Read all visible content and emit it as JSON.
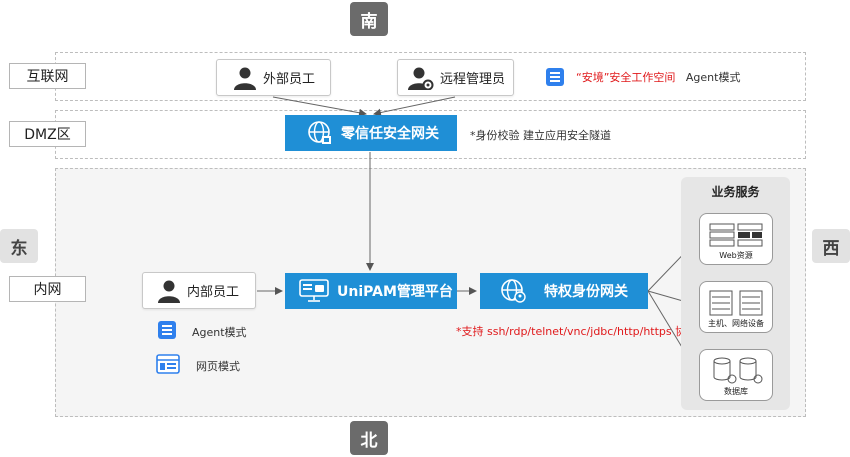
{
  "directions": {
    "south": "南",
    "north": "北",
    "east": "东",
    "west": "西"
  },
  "zones": {
    "internet": "互联网",
    "dmz": "DMZ区",
    "intranet": "内网"
  },
  "nodes": {
    "external_staff": "外部员工",
    "remote_admin": "远程管理员",
    "zero_trust_gateway": "零信任安全网关",
    "unipam": "UniPAM管理平台",
    "privileged_gateway": "特权身份网关",
    "internal_staff": "内部员工"
  },
  "notes": {
    "workspace_quoted": "“安境”安全工作空间",
    "workspace_agent": "Agent模式",
    "gateway_note": "*身份校验 建立应用安全隧道",
    "agent_mode": "Agent模式",
    "web_mode": "网页模式",
    "protocols": "*支持 ssh/rdp/telnet/vnc/jdbc/http/https 协议"
  },
  "services": {
    "title": "业务服务",
    "web": "Web资源",
    "hosts": "主机、网络设备",
    "db": "数据库"
  },
  "colors": {
    "accent": "#1f8fd6",
    "highlight": "#e0191b",
    "direction_bg": "#6b6b6b"
  }
}
